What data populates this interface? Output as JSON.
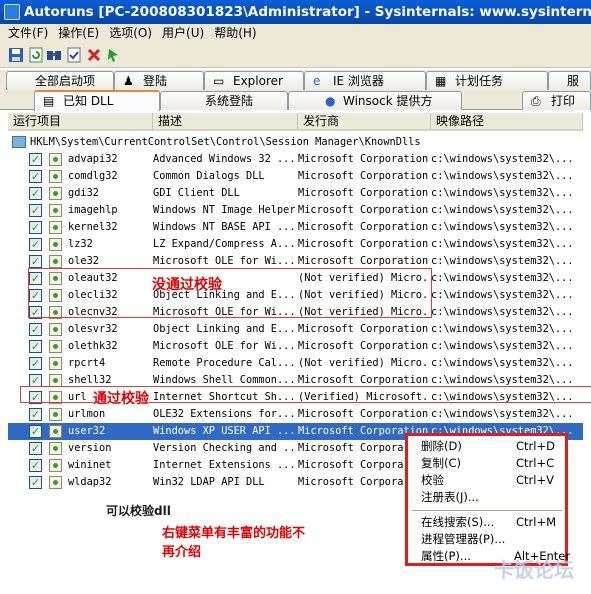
{
  "window": {
    "title": "Autoruns [PC-200808301823\\Administrator] - Sysinternals: www.sysinternals.com"
  },
  "menu": [
    "文件(F)",
    "操作(E)",
    "选项(O)",
    "用户(U)",
    "帮助(H)"
  ],
  "toolbar": {
    "icons": [
      "save-icon",
      "refresh-icon",
      "find-icon",
      "verify-icon",
      "delete-icon",
      "jump-icon"
    ]
  },
  "tabs": {
    "row1": [
      "全部启动项",
      "登陆",
      "Explorer",
      "IE 浏览器",
      "计划任务",
      "服"
    ],
    "row2": [
      "已知 DLL",
      "系统登陆",
      "Winsock 提供方",
      "打印"
    ],
    "active": "已知 DLL"
  },
  "columns": [
    "运行项目",
    "描述",
    "发行商",
    "映像路径"
  ],
  "group_key": "HKLM\\System\\CurrentControlSet\\Control\\Session Manager\\KnownDlls",
  "rows": [
    {
      "name": "advapi32",
      "desc": "Advanced Windows 32 ...",
      "pub": "Microsoft Corporation",
      "path": "c:\\windows\\system32\\..."
    },
    {
      "name": "comdlg32",
      "desc": "Common Dialogs DLL",
      "pub": "Microsoft Corporation",
      "path": "c:\\windows\\system32\\..."
    },
    {
      "name": "gdi32",
      "desc": "GDI Client DLL",
      "pub": "Microsoft Corporation",
      "path": "c:\\windows\\system32\\..."
    },
    {
      "name": "imagehlp",
      "desc": "Windows NT Image Helper",
      "pub": "Microsoft Corporation",
      "path": "c:\\windows\\system32\\..."
    },
    {
      "name": "kernel32",
      "desc": "Windows NT BASE API ...",
      "pub": "Microsoft Corporation",
      "path": "c:\\windows\\system32\\..."
    },
    {
      "name": "lz32",
      "desc": "LZ Expand/Compress A...",
      "pub": "Microsoft Corporation",
      "path": "c:\\windows\\system32\\..."
    },
    {
      "name": "ole32",
      "desc": "Microsoft OLE for Wi...",
      "pub": "Microsoft Corporation",
      "path": "c:\\windows\\system32\\..."
    },
    {
      "name": "oleaut32",
      "desc": "",
      "pub": "(Not verified) Micro...",
      "path": "c:\\windows\\system32\\..."
    },
    {
      "name": "olecli32",
      "desc": "Object Linking and E...",
      "pub": "(Not verified) Micro...",
      "path": "c:\\windows\\system32\\..."
    },
    {
      "name": "olecnv32",
      "desc": "Microsoft OLE for Wi...",
      "pub": "(Not verified) Micro...",
      "path": "c:\\windows\\system32\\..."
    },
    {
      "name": "olesvr32",
      "desc": "Object Linking and E...",
      "pub": "Microsoft Corporation",
      "path": "c:\\windows\\system32\\..."
    },
    {
      "name": "olethk32",
      "desc": "Microsoft OLE for Wi...",
      "pub": "Microsoft Corporation",
      "path": "c:\\windows\\system32\\..."
    },
    {
      "name": "rpcrt4",
      "desc": "Remote Procedure Cal...",
      "pub": "(Not verified) Micro...",
      "path": "c:\\windows\\system32\\..."
    },
    {
      "name": "shell32",
      "desc": "Windows Shell Common...",
      "pub": "Microsoft Corporation",
      "path": "c:\\windows\\system32\\..."
    },
    {
      "name": "url",
      "desc": "Internet Shortcut Sh...",
      "pub": "(Verified) Microsoft...",
      "path": "c:\\windows\\system32\\..."
    },
    {
      "name": "urlmon",
      "desc": "OLE32 Extensions for...",
      "pub": "Microsoft Corporation",
      "path": "c:\\windows\\system32\\..."
    },
    {
      "name": "user32",
      "desc": "Windows XP USER API ...",
      "pub": "Microsoft Corporation",
      "path": "c:\\windows\\system32\\..."
    },
    {
      "name": "version",
      "desc": "Version Checking and ...",
      "pub": "Microsoft Corpora",
      "path": ""
    },
    {
      "name": "wininet",
      "desc": "Internet Extensions ...",
      "pub": "Microsoft Corpora",
      "path": ""
    },
    {
      "name": "wldap32",
      "desc": "Win32 LDAP API DLL",
      "pub": "Microsoft Corpora",
      "path": ""
    }
  ],
  "selected_row": "user32",
  "annotations": {
    "not_verified": "没通过校验",
    "verified": "通过校验",
    "can_verify": "可以校验dll",
    "context_note_1": "右键菜单有丰富的功能不",
    "context_note_2": "再介绍"
  },
  "context_menu": [
    {
      "label": "删除(D)",
      "shortcut": "Ctrl+D"
    },
    {
      "label": "复制(C)",
      "shortcut": "Ctrl+C"
    },
    {
      "label": "校验",
      "shortcut": "Ctrl+V"
    },
    {
      "label": "注册表(J)...",
      "shortcut": ""
    },
    {
      "label": "在线搜索(S)...",
      "shortcut": "Ctrl+M"
    },
    {
      "label": "进程管理器(P)...",
      "shortcut": ""
    },
    {
      "label": "属性(P)...",
      "shortcut": "Alt+Enter"
    }
  ],
  "watermark": "卡饭论坛",
  "colors": {
    "title_bar": "#0843a8",
    "selection": "#316ac5",
    "annotation": "#e60000"
  }
}
